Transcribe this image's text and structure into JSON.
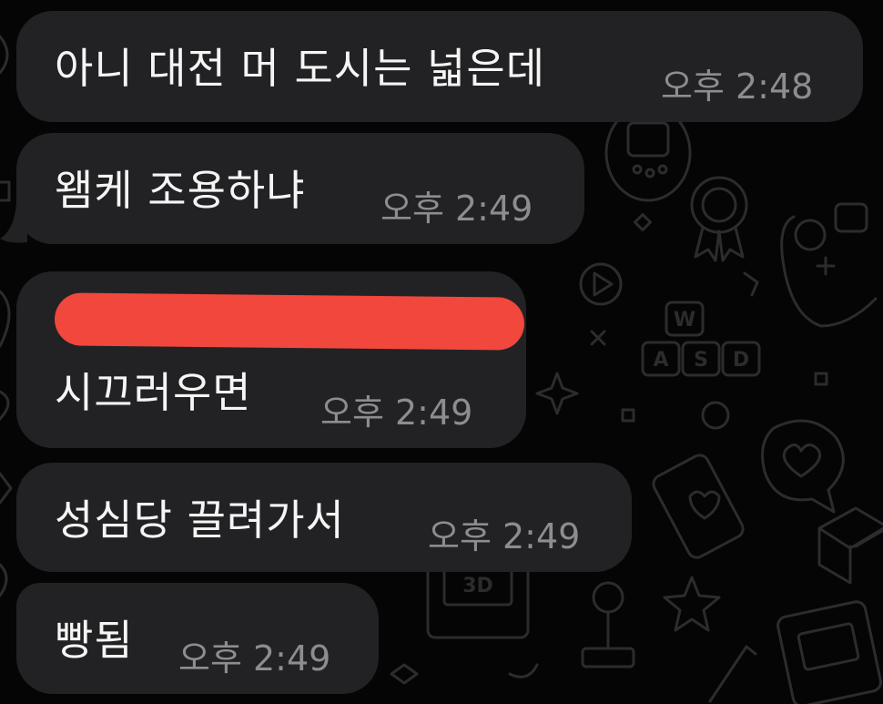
{
  "chat": {
    "messages": [
      {
        "text": "아니 대전 머 도시는 넓은데",
        "time": "오후 2:48"
      },
      {
        "text": "왬케 조용하냐",
        "time": "오후 2:49"
      },
      {
        "text": "시끄러우면",
        "time": "오후 2:49",
        "redacted_line": true
      },
      {
        "text": "성심당 끌려가서",
        "time": "오후 2:49"
      },
      {
        "text": "빵됨",
        "time": "오후 2:49"
      }
    ]
  },
  "wallpaper": {
    "keycaps": [
      "W",
      "A",
      "S",
      "D"
    ],
    "console_label": "3D",
    "icons": [
      "play-icon",
      "badge-icon",
      "gamepad-icon",
      "heart-bubble-icon",
      "phone-heart-icon",
      "star-icon",
      "joystick-icon",
      "handheld-console-icon",
      "tamagotchi-icon",
      "sparkle-icon"
    ]
  },
  "colors": {
    "background": "#050505",
    "bubble": "#222224",
    "text": "#f5f5f5",
    "time": "#8d8d90",
    "redaction": "#f2473d",
    "doodle": "#2a2a2c"
  }
}
